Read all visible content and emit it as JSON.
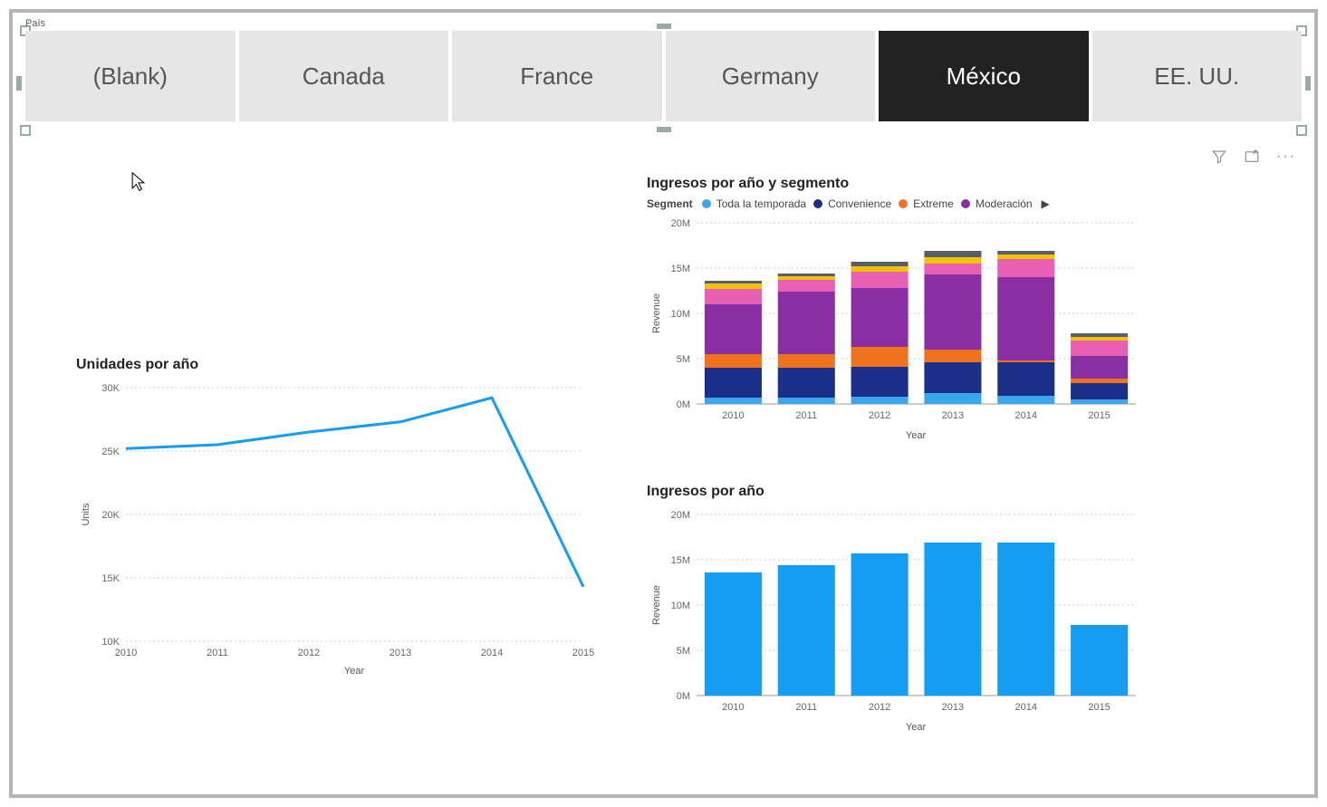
{
  "slicer": {
    "label": "País",
    "items": [
      {
        "label": "(Blank)",
        "selected": false
      },
      {
        "label": "Canada",
        "selected": false
      },
      {
        "label": "France",
        "selected": false
      },
      {
        "label": "Germany",
        "selected": false
      },
      {
        "label": "México",
        "selected": true
      },
      {
        "label": "EE. UU.",
        "selected": false
      }
    ]
  },
  "toolbar": {
    "filter_tooltip": "Filtros",
    "focus_tooltip": "Modo enfocado",
    "more_tooltip": "Más opciones"
  },
  "charts": {
    "units": {
      "title": "Unidades por año",
      "xlabel": "Year",
      "ylabel": "Units",
      "yticks": [
        "10K",
        "15K",
        "20K",
        "25K",
        "30K"
      ]
    },
    "segment": {
      "title": "Ingresos por año y segmento",
      "xlabel": "Year",
      "ylabel": "Revenue",
      "legend_title": "Segment",
      "legend_items": [
        {
          "label": "Toda la temporada",
          "color": "#39a6f0"
        },
        {
          "label": "Convenience",
          "color": "#1c2f88"
        },
        {
          "label": "Extreme",
          "color": "#f0721e"
        },
        {
          "label": "Moderación",
          "color": "#8a2fa3"
        }
      ],
      "yticks": [
        "0M",
        "5M",
        "10M",
        "15M",
        "20M"
      ]
    },
    "revenue": {
      "title": "Ingresos por año",
      "xlabel": "Year",
      "ylabel": "Revenue",
      "yticks": [
        "0M",
        "5M",
        "10M",
        "15M",
        "20M"
      ]
    }
  },
  "chart_data": [
    {
      "id": "units",
      "type": "line",
      "title": "Unidades por año",
      "xlabel": "Year",
      "ylabel": "Units",
      "x": [
        2010,
        2011,
        2012,
        2013,
        2014,
        2015
      ],
      "values": [
        25200,
        25500,
        26500,
        27300,
        29200,
        14300
      ],
      "ylim": [
        10000,
        30000
      ]
    },
    {
      "id": "segment",
      "type": "bar",
      "stacked": true,
      "title": "Ingresos por año y segmento",
      "xlabel": "Year",
      "ylabel": "Revenue",
      "categories": [
        2010,
        2011,
        2012,
        2013,
        2014,
        2015
      ],
      "series": [
        {
          "name": "Toda la temporada",
          "color": "#39a6f0",
          "values": [
            700000,
            700000,
            800000,
            1200000,
            900000,
            500000
          ]
        },
        {
          "name": "Convenience",
          "color": "#1c2f88",
          "values": [
            3300000,
            3300000,
            3300000,
            3400000,
            3700000,
            1800000
          ]
        },
        {
          "name": "Extreme",
          "color": "#f0721e",
          "values": [
            1500000,
            1500000,
            2200000,
            1400000,
            200000,
            500000
          ]
        },
        {
          "name": "Moderación",
          "color": "#8a2fa3",
          "values": [
            5500000,
            6900000,
            6500000,
            8300000,
            9200000,
            2500000
          ]
        },
        {
          "name": "Pink (other)",
          "color": "#e85fb3",
          "values": [
            1700000,
            1300000,
            1800000,
            1200000,
            2000000,
            1700000
          ]
        },
        {
          "name": "Yellow (other)",
          "color": "#f2c200",
          "values": [
            600000,
            400000,
            600000,
            700000,
            500000,
            400000
          ]
        },
        {
          "name": "Slate (other)",
          "color": "#55606a",
          "values": [
            300000,
            300000,
            500000,
            700000,
            400000,
            400000
          ]
        }
      ],
      "ylim": [
        0,
        20000000
      ]
    },
    {
      "id": "revenue",
      "type": "bar",
      "title": "Ingresos por año",
      "xlabel": "Year",
      "ylabel": "Revenue",
      "categories": [
        2010,
        2011,
        2012,
        2013,
        2014,
        2015
      ],
      "values": [
        13600000,
        14400000,
        15700000,
        16900000,
        16900000,
        7800000
      ],
      "ylim": [
        0,
        20000000
      ],
      "color": "#159cf3"
    }
  ]
}
